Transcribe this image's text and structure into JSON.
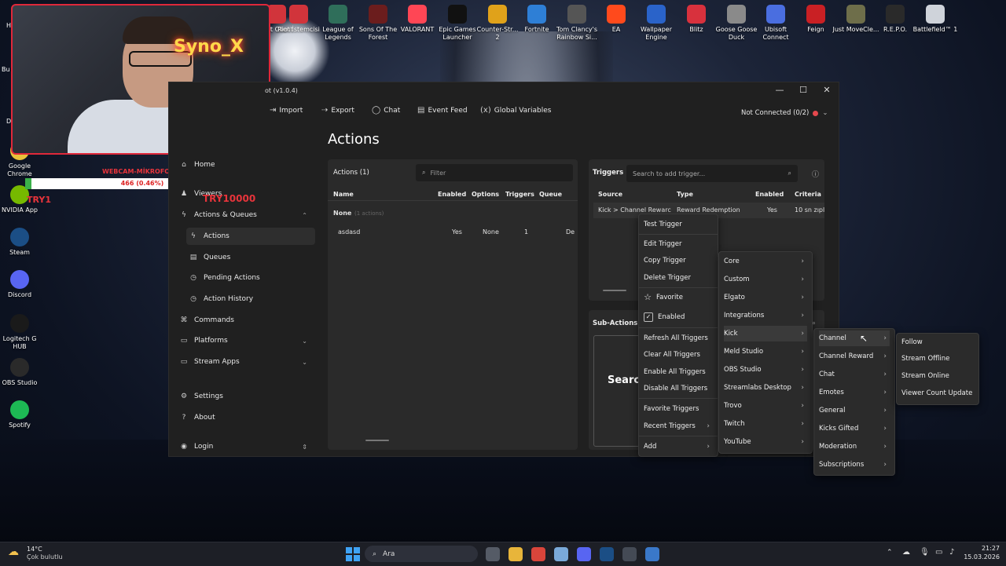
{
  "desktop": {
    "icons": [
      {
        "label": "Riot Client",
        "color": "#d1343b"
      },
      {
        "label": "Riot İstemcisi",
        "color": "#d1343b"
      },
      {
        "label": "League of Legends",
        "color": "#2f6e5a"
      },
      {
        "label": "Sons Of The Forest",
        "color": "#6b1d1d"
      },
      {
        "label": "VALORANT",
        "color": "#ff4655"
      },
      {
        "label": "Epic Games Launcher",
        "color": "#111111"
      },
      {
        "label": "Counter-Str... 2",
        "color": "#e0a21a"
      },
      {
        "label": "Fortnite",
        "color": "#2e7fd6"
      },
      {
        "label": "Tom Clancy's Rainbow Si...",
        "color": "#555555"
      },
      {
        "label": "EA",
        "color": "#ff4a1c"
      },
      {
        "label": "Wallpaper Engine",
        "color": "#2a63c9"
      },
      {
        "label": "Blitz",
        "color": "#d8313d"
      },
      {
        "label": "Goose Goose Duck",
        "color": "#8a8a8a"
      },
      {
        "label": "Ubisoft Connect",
        "color": "#4a6ee0"
      },
      {
        "label": "Feign",
        "color": "#c92024"
      },
      {
        "label": "Just MoveCle...",
        "color": "#6e6e4a"
      },
      {
        "label": "R.E.P.O.",
        "color": "#2a2a2a"
      },
      {
        "label": "Battlefield™ 1",
        "color": "#cfd3da"
      }
    ],
    "left_icons": [
      {
        "label": "Google Chrome",
        "color": "#e8c23a"
      },
      {
        "label": "NVIDIA App",
        "color": "#76b900"
      },
      {
        "label": "Steam",
        "color": "#1b4e85"
      },
      {
        "label": "Discord",
        "color": "#5865f2"
      },
      {
        "label": "Logitech G HUB",
        "color": "#1a1a1a"
      },
      {
        "label": "OBS Studio",
        "color": "#2a2a2a"
      },
      {
        "label": "Spotify",
        "color": "#1db954"
      }
    ],
    "edge_labels": [
      "H",
      "Bu",
      "De"
    ]
  },
  "webcam": {
    "neon_text": "Syno_X",
    "overlay_label": "WEBCAM-MİKROFON",
    "progress_text": "466 (0.46%)",
    "progress_fraction": 0.0046,
    "try1": "TRY1",
    "try2": "TRY10000"
  },
  "window": {
    "title": "ot (v1.0.4)",
    "controls": [
      "—",
      "☐",
      "✕"
    ],
    "toolbar": [
      {
        "icon": "import-icon",
        "glyph": "⇥",
        "label": "Import"
      },
      {
        "icon": "export-icon",
        "glyph": "⇢",
        "label": "Export"
      },
      {
        "icon": "chat-icon",
        "glyph": "◯",
        "label": "Chat"
      },
      {
        "icon": "event-feed-icon",
        "glyph": "▤",
        "label": "Event Feed"
      },
      {
        "icon": "variables-icon",
        "glyph": "(x)",
        "label": "Global Variables"
      }
    ],
    "connection": "Not Connected (0/2)",
    "status_color": "#e5484d"
  },
  "sidebar": [
    {
      "label": "Home",
      "glyph": "⌂",
      "sub": false
    },
    {
      "label": "Viewers",
      "glyph": "♟",
      "sub": false
    },
    {
      "label": "Actions & Queues",
      "glyph": "ϟ",
      "sub": false,
      "chev": "⌃"
    },
    {
      "label": "Actions",
      "glyph": "ϟ",
      "sub": true,
      "sel": true
    },
    {
      "label": "Queues",
      "glyph": "▤",
      "sub": true
    },
    {
      "label": "Pending Actions",
      "glyph": "◷",
      "sub": true
    },
    {
      "label": "Action History",
      "glyph": "◷",
      "sub": true
    },
    {
      "label": "Commands",
      "glyph": "⌘",
      "sub": false
    },
    {
      "label": "Platforms",
      "glyph": "▭",
      "sub": false,
      "chev": "⌄"
    },
    {
      "label": "Stream Apps",
      "glyph": "▭",
      "sub": false,
      "chev": "⌄"
    },
    {
      "label": "Settings",
      "glyph": "⚙",
      "sub": false
    },
    {
      "label": "About",
      "glyph": "?",
      "sub": false
    },
    {
      "label": "Login",
      "glyph": "◉",
      "sub": false,
      "chev": "⇕"
    }
  ],
  "page_title": "Actions",
  "actions_panel": {
    "header": "Actions (1)",
    "filter_placeholder": "Filter",
    "columns": [
      "Name",
      "Enabled",
      "Options",
      "Triggers",
      "Queue"
    ],
    "group": "None",
    "group_count": "(1 actions)",
    "rows": [
      {
        "name": "asdasd",
        "enabled": "Yes",
        "options": "None",
        "triggers": "1",
        "queue": "De"
      }
    ]
  },
  "triggers_panel": {
    "header": "Triggers",
    "search_placeholder": "Search to add trigger...",
    "columns": [
      "Source",
      "Type",
      "Enabled",
      "Criteria"
    ],
    "rows": [
      {
        "source": "Kick > Channel Rewarc",
        "type": "Reward Redemption",
        "enabled": "Yes",
        "criteria": "10 sn zıpl"
      }
    ]
  },
  "subactions_panel": {
    "header": "Sub-Actions",
    "search_text": "Searc"
  },
  "menu1": [
    "Test Trigger",
    "Edit Trigger",
    "Copy Trigger",
    "Delete Trigger",
    "Favorite",
    "Enabled",
    "Refresh All Triggers",
    "Clear All Triggers",
    "Enable All Triggers",
    "Disable All Triggers",
    "Favorite Triggers",
    "Recent Triggers",
    "Add"
  ],
  "menu2": [
    "Core",
    "Custom",
    "Elgato",
    "Integrations",
    "Kick",
    "Meld Studio",
    "OBS Studio",
    "Streamlabs Desktop",
    "Trovo",
    "Twitch",
    "YouTube"
  ],
  "menu3": [
    "Channel",
    "Channel Reward",
    "Chat",
    "Emotes",
    "General",
    "Kicks Gifted",
    "Moderation",
    "Subscriptions"
  ],
  "menu4": [
    "Follow",
    "Stream Offline",
    "Stream Online",
    "Viewer Count Update"
  ],
  "taskbar": {
    "weather_temp": "14°C",
    "weather_desc": "Çok bulutlu",
    "search_placeholder": "Ara",
    "time": "21:27",
    "date": "15.03.2026",
    "apps": [
      {
        "name": "task-view-icon",
        "color": "#555b66"
      },
      {
        "name": "file-explorer-icon",
        "color": "#e8b53a"
      },
      {
        "name": "chrome-icon",
        "color": "#d9453b"
      },
      {
        "name": "streamerbot-icon",
        "color": "#7aa9d9"
      },
      {
        "name": "discord-icon",
        "color": "#5865f2"
      },
      {
        "name": "steam-icon",
        "color": "#1b4e85"
      },
      {
        "name": "obs-icon",
        "color": "#444a55"
      },
      {
        "name": "app-icon",
        "color": "#3a78c9"
      }
    ]
  }
}
